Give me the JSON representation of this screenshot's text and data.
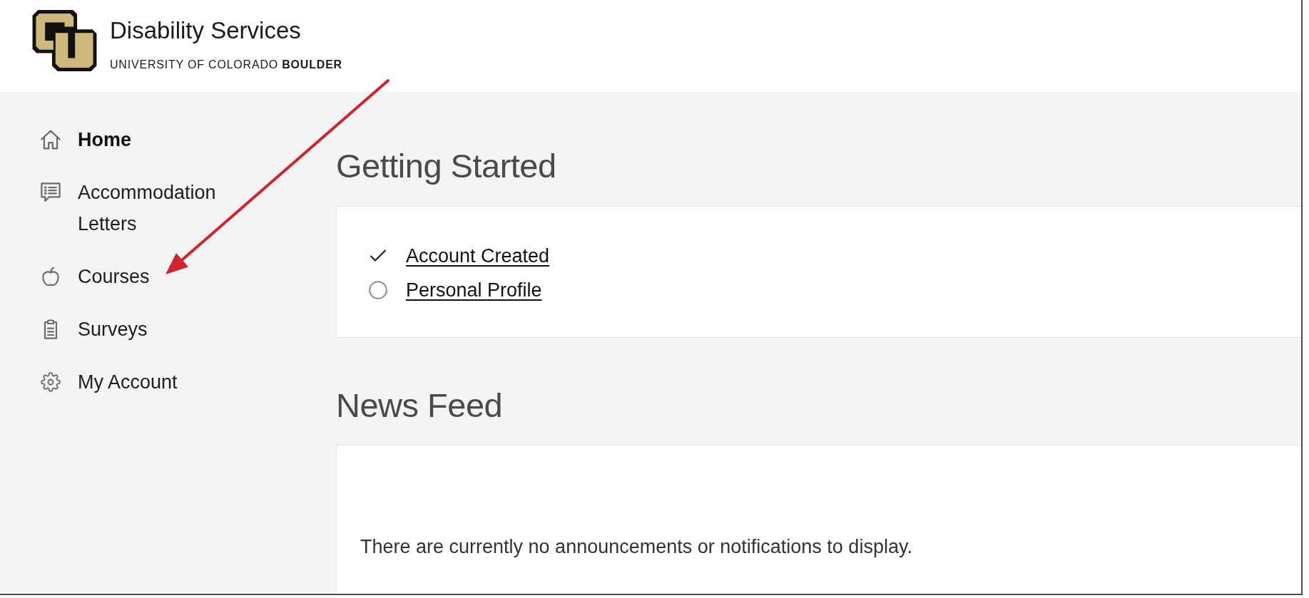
{
  "header": {
    "title": "Disability Services",
    "subtitle": "UNIVERSITY OF COLORADO **BOULDER**"
  },
  "sidebar": {
    "items": [
      {
        "label": "Home",
        "selected": true
      },
      {
        "label": "Accommodation Letters",
        "selected": false
      },
      {
        "label": "Courses",
        "selected": false
      },
      {
        "label": "Surveys",
        "selected": false
      },
      {
        "label": "My Account",
        "selected": false
      }
    ]
  },
  "sections": [
    {
      "kind": "checklist",
      "title": "Getting Started",
      "items": [
        {
          "label": "Account Created",
          "checked": true
        },
        {
          "label": "Personal Profile",
          "checked": false
        }
      ]
    },
    {
      "kind": "message",
      "title": "News Feed",
      "text": "There are currently no announcements or notifications to display."
    }
  ],
  "annotations": [
    {
      "kind": "arrow"
    }
  ]
}
